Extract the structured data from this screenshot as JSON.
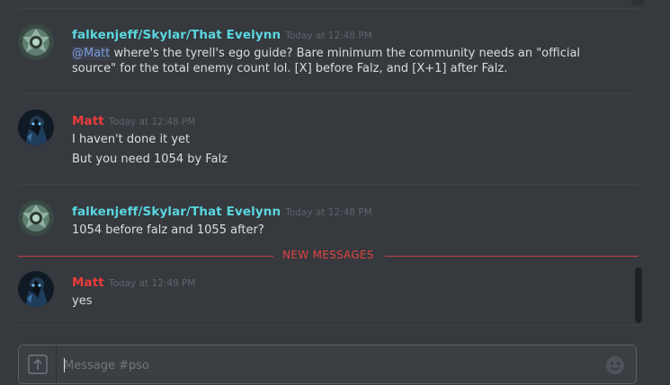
{
  "messages": [
    {
      "author": "falkenjeff/Skylar/That Evelynn",
      "timestamp": "Today at 12:48 PM",
      "mention": "@Matt",
      "lines": [
        " where's the tyrell's ego guide? Bare minimum the community needs an \"official",
        "source\" for the total enemy count lol. [X] before Falz, and [X+1] after Falz."
      ]
    },
    {
      "author": "Matt",
      "timestamp": "Today at 12:48 PM",
      "lines": [
        "I haven't done it yet",
        "But you need 1054 by Falz"
      ]
    },
    {
      "author": "falkenjeff/Skylar/That Evelynn",
      "timestamp": "Today at 12:48 PM",
      "lines": [
        "1054 before falz and 1055 after?"
      ]
    },
    {
      "author": "Matt",
      "timestamp": "Today at 12:49 PM",
      "lines": [
        "yes"
      ]
    }
  ],
  "divider": {
    "label": "NEW MESSAGES"
  },
  "composer": {
    "placeholder": "Message #pso"
  },
  "icons": {
    "upload": "upload-arrow-icon",
    "emoji": "emoji-picker-icon",
    "avatar_falken": "emblem-avatar-icon",
    "avatar_matt": "dark-character-avatar-icon"
  },
  "colors": {
    "background": "#36393e",
    "falken_name": "#5ad7e0",
    "matt_name": "#ec3b3b",
    "mention": "#7a9be0",
    "new_messages": "#e1433f"
  }
}
